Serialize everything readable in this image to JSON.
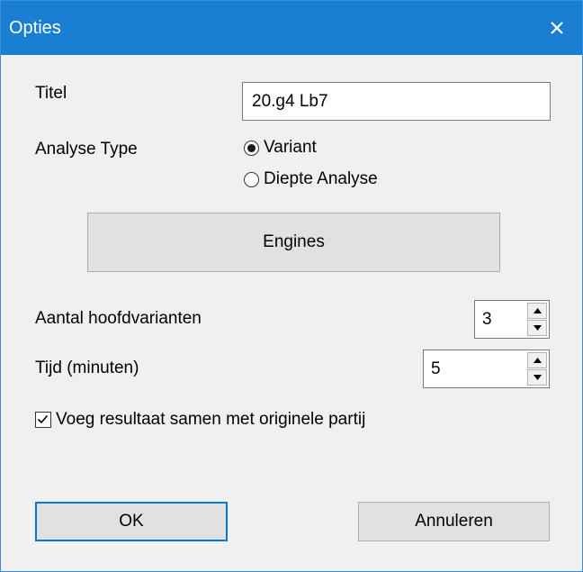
{
  "window": {
    "title": "Opties"
  },
  "titel": {
    "label": "Titel",
    "value": "20.g4 Lb7"
  },
  "analyse_type": {
    "label": "Analyse Type",
    "options": [
      {
        "label": "Variant",
        "selected": true
      },
      {
        "label": "Diepte Analyse",
        "selected": false
      }
    ]
  },
  "engines_button": "Engines",
  "hoofdvarianten": {
    "label": "Aantal hoofdvarianten",
    "value": "3"
  },
  "tijd": {
    "label": "Tijd (minuten)",
    "value": "5"
  },
  "merge": {
    "label": "Voeg resultaat samen met originele partij",
    "checked": true
  },
  "buttons": {
    "ok": "OK",
    "cancel": "Annuleren"
  },
  "colors": {
    "titlebar": "#1a7fd3",
    "accent": "#0078d7",
    "background": "#f0f0f0"
  },
  "icons": [
    "close-icon",
    "spin-up-icon",
    "spin-down-icon",
    "checkmark-icon"
  ]
}
